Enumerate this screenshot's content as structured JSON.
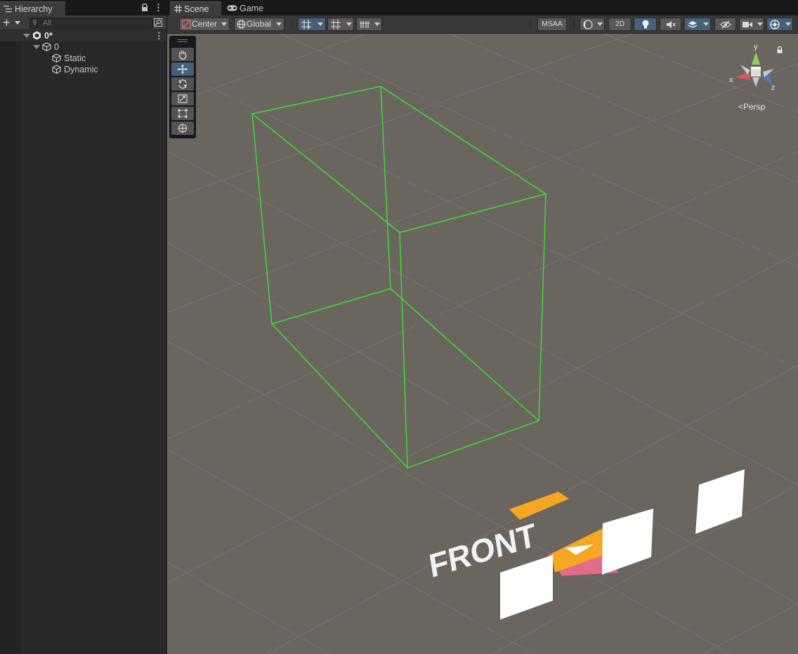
{
  "hierarchy": {
    "tab_label": "Hierarchy",
    "search_placeholder": "All",
    "add_label": "+",
    "items": [
      {
        "label": "0*",
        "level": 0,
        "icon": "unity-scene-icon"
      },
      {
        "label": "0",
        "level": 1,
        "icon": "cube-icon"
      },
      {
        "label": "Static",
        "level": 2,
        "icon": "cube-icon"
      },
      {
        "label": "Dynamic",
        "level": 2,
        "icon": "cube-icon"
      }
    ]
  },
  "scene_tabs": [
    {
      "label": "Scene",
      "icon": "grid-icon",
      "active": true
    },
    {
      "label": "Game",
      "icon": "gamepad-icon",
      "active": false
    }
  ],
  "scene_toolbar": {
    "pivot_mode": "Center",
    "pivot_rotation": "Global",
    "msaa_label": "MSAA",
    "twod_label": "2D"
  },
  "tools": [
    {
      "name": "hand-tool",
      "icon": "hand-icon",
      "active": false
    },
    {
      "name": "move-tool",
      "icon": "move-icon",
      "active": true
    },
    {
      "name": "rotate-tool",
      "icon": "rotate-icon",
      "active": false
    },
    {
      "name": "scale-tool",
      "icon": "scale-icon",
      "active": false
    },
    {
      "name": "rect-tool",
      "icon": "rect-icon",
      "active": false
    },
    {
      "name": "transform-tool",
      "icon": "transform-icon",
      "active": false
    }
  ],
  "gizmo": {
    "x_label": "x",
    "y_label": "y",
    "z_label": "z",
    "projection_label": "<Persp"
  },
  "scene_content": {
    "floor_text": "FRONT"
  },
  "colors": {
    "scene_background": "#6b6560",
    "grid_line": "#7a746e",
    "bounds_wire": "#2ef02e",
    "active_blue": "#46607c",
    "axis_x": "#d65c5c",
    "axis_y": "#8dd05a",
    "axis_z": "#4f79c9",
    "front_orange": "#f5a623",
    "front_pink": "#e96a8d"
  }
}
